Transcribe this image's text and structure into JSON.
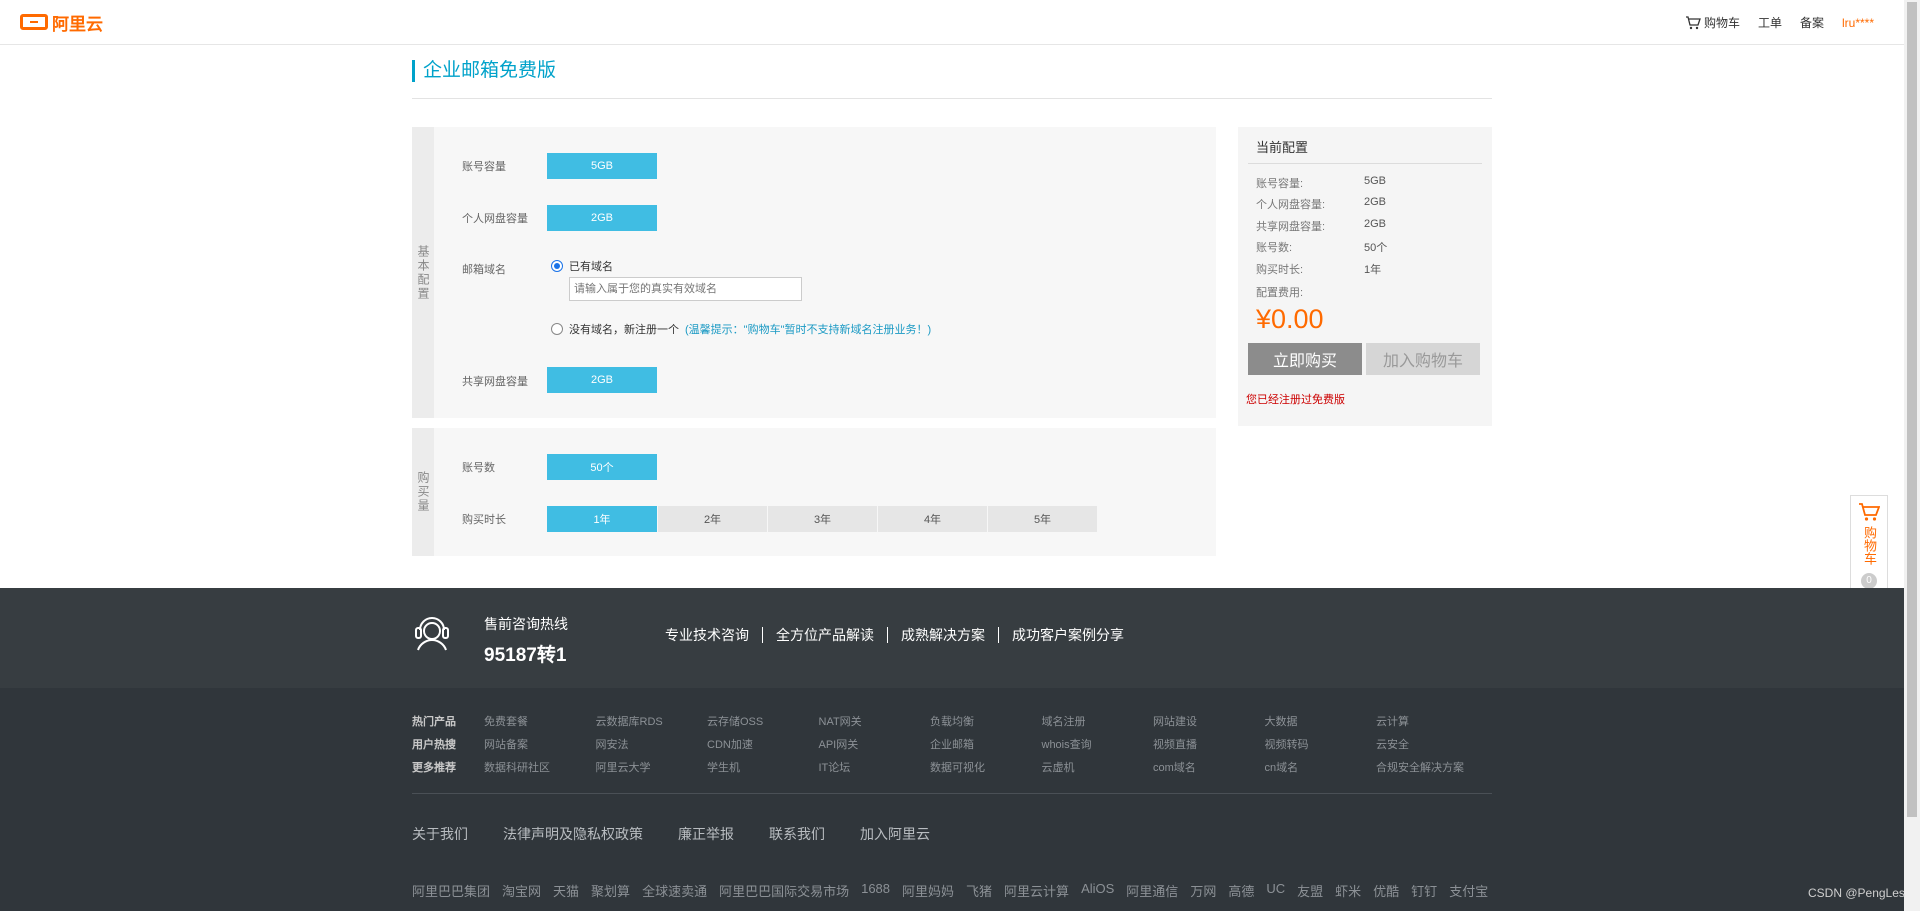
{
  "header": {
    "logo_text": "阿里云",
    "nav": {
      "cart": "购物车",
      "ticket": "工单",
      "filing": "备案",
      "user": "lru****"
    }
  },
  "page_title": "企业邮箱免费版",
  "basic_config": {
    "side_label": "基本配置",
    "account_capacity": {
      "label": "账号容量",
      "value": "5GB"
    },
    "personal_disk": {
      "label": "个人网盘容量",
      "value": "2GB"
    },
    "domain": {
      "label": "邮箱域名",
      "option_have": "已有域名",
      "input_placeholder": "请输入属于您的真实有效域名",
      "option_none": "没有域名，新注册一个",
      "hint": "(温馨提示：\"购物车\"暂时不支持新域名注册业务！)"
    },
    "shared_disk": {
      "label": "共享网盘容量",
      "value": "2GB"
    }
  },
  "purchase_config": {
    "side_label": "购买量",
    "accounts": {
      "label": "账号数",
      "value": "50个"
    },
    "duration": {
      "label": "购买时长",
      "options": [
        "1年",
        "2年",
        "3年",
        "4年",
        "5年"
      ],
      "selected": "1年"
    }
  },
  "summary": {
    "title": "当前配置",
    "rows": [
      {
        "label": "账号容量:",
        "value": "5GB"
      },
      {
        "label": "个人网盘容量:",
        "value": "2GB"
      },
      {
        "label": "共享网盘容量:",
        "value": "2GB"
      },
      {
        "label": "账号数:",
        "value": "50个"
      },
      {
        "label": "购买时长:",
        "value": "1年"
      }
    ],
    "fee_label": "配置费用:",
    "price": "¥0.00",
    "buy_now": "立即购买",
    "add_cart": "加入购物车",
    "notice": "您已经注册过免费版"
  },
  "float_cart": {
    "label": "购物车",
    "count": "0"
  },
  "footer": {
    "hotline_title": "售前咨询热线",
    "hotline_number": "95187转1",
    "service_links": [
      "专业技术咨询",
      "全方位产品解读",
      "成熟解决方案",
      "成功客户案例分享"
    ],
    "categories": [
      "热门产品",
      "用户热搜",
      "更多推荐"
    ],
    "links": [
      "免费套餐",
      "云数据库RDS",
      "云存储OSS",
      "NAT网关",
      "负载均衡",
      "域名注册",
      "网站建设",
      "大数据",
      "云计算",
      "网站备案",
      "网安法",
      "CDN加速",
      "API网关",
      "企业邮箱",
      "whois查询",
      "视频直播",
      "视频转码",
      "云安全",
      "数据科研社区",
      "阿里云大学",
      "学生机",
      "IT论坛",
      "数据可视化",
      "云虚机",
      "com域名",
      "cn域名",
      "合规安全解决方案"
    ],
    "about_links": [
      "关于我们",
      "法律声明及隐私权政策",
      "廉正举报",
      "联系我们",
      "加入阿里云"
    ],
    "group_links": [
      "阿里巴巴集团",
      "淘宝网",
      "天猫",
      "聚划算",
      "全球速卖通",
      "阿里巴巴国际交易市场",
      "1688",
      "阿里妈妈",
      "飞猪",
      "阿里云计算",
      "AliOS",
      "阿里通信",
      "万网",
      "高德",
      "UC",
      "友盟",
      "虾米",
      "优酷",
      "钉钉",
      "支付宝"
    ]
  },
  "watermark": "CSDN @PengLes"
}
